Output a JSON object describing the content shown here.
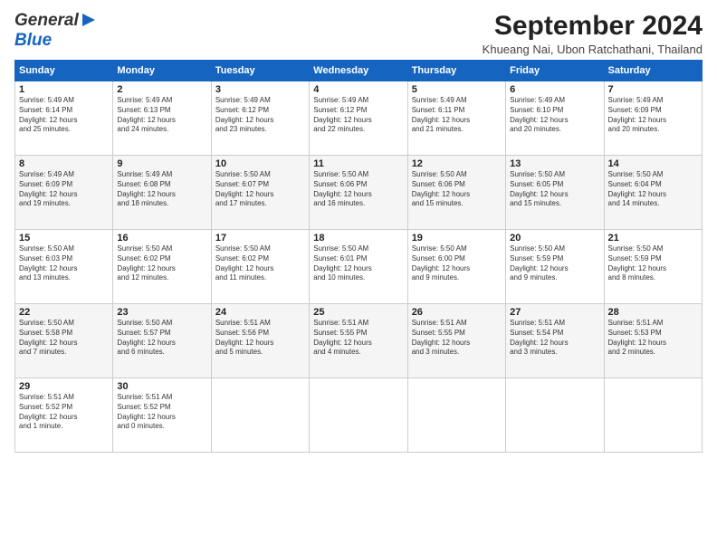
{
  "header": {
    "logo_general": "General",
    "logo_blue": "Blue",
    "month_title": "September 2024",
    "subtitle": "Khueang Nai, Ubon Ratchathani, Thailand"
  },
  "weekdays": [
    "Sunday",
    "Monday",
    "Tuesday",
    "Wednesday",
    "Thursday",
    "Friday",
    "Saturday"
  ],
  "weeks": [
    [
      {
        "day": "1",
        "lines": [
          "Sunrise: 5:49 AM",
          "Sunset: 6:14 PM",
          "Daylight: 12 hours",
          "and 25 minutes."
        ]
      },
      {
        "day": "2",
        "lines": [
          "Sunrise: 5:49 AM",
          "Sunset: 6:13 PM",
          "Daylight: 12 hours",
          "and 24 minutes."
        ]
      },
      {
        "day": "3",
        "lines": [
          "Sunrise: 5:49 AM",
          "Sunset: 6:12 PM",
          "Daylight: 12 hours",
          "and 23 minutes."
        ]
      },
      {
        "day": "4",
        "lines": [
          "Sunrise: 5:49 AM",
          "Sunset: 6:12 PM",
          "Daylight: 12 hours",
          "and 22 minutes."
        ]
      },
      {
        "day": "5",
        "lines": [
          "Sunrise: 5:49 AM",
          "Sunset: 6:11 PM",
          "Daylight: 12 hours",
          "and 21 minutes."
        ]
      },
      {
        "day": "6",
        "lines": [
          "Sunrise: 5:49 AM",
          "Sunset: 6:10 PM",
          "Daylight: 12 hours",
          "and 20 minutes."
        ]
      },
      {
        "day": "7",
        "lines": [
          "Sunrise: 5:49 AM",
          "Sunset: 6:09 PM",
          "Daylight: 12 hours",
          "and 20 minutes."
        ]
      }
    ],
    [
      {
        "day": "8",
        "lines": [
          "Sunrise: 5:49 AM",
          "Sunset: 6:09 PM",
          "Daylight: 12 hours",
          "and 19 minutes."
        ]
      },
      {
        "day": "9",
        "lines": [
          "Sunrise: 5:49 AM",
          "Sunset: 6:08 PM",
          "Daylight: 12 hours",
          "and 18 minutes."
        ]
      },
      {
        "day": "10",
        "lines": [
          "Sunrise: 5:50 AM",
          "Sunset: 6:07 PM",
          "Daylight: 12 hours",
          "and 17 minutes."
        ]
      },
      {
        "day": "11",
        "lines": [
          "Sunrise: 5:50 AM",
          "Sunset: 6:06 PM",
          "Daylight: 12 hours",
          "and 16 minutes."
        ]
      },
      {
        "day": "12",
        "lines": [
          "Sunrise: 5:50 AM",
          "Sunset: 6:06 PM",
          "Daylight: 12 hours",
          "and 15 minutes."
        ]
      },
      {
        "day": "13",
        "lines": [
          "Sunrise: 5:50 AM",
          "Sunset: 6:05 PM",
          "Daylight: 12 hours",
          "and 15 minutes."
        ]
      },
      {
        "day": "14",
        "lines": [
          "Sunrise: 5:50 AM",
          "Sunset: 6:04 PM",
          "Daylight: 12 hours",
          "and 14 minutes."
        ]
      }
    ],
    [
      {
        "day": "15",
        "lines": [
          "Sunrise: 5:50 AM",
          "Sunset: 6:03 PM",
          "Daylight: 12 hours",
          "and 13 minutes."
        ]
      },
      {
        "day": "16",
        "lines": [
          "Sunrise: 5:50 AM",
          "Sunset: 6:02 PM",
          "Daylight: 12 hours",
          "and 12 minutes."
        ]
      },
      {
        "day": "17",
        "lines": [
          "Sunrise: 5:50 AM",
          "Sunset: 6:02 PM",
          "Daylight: 12 hours",
          "and 11 minutes."
        ]
      },
      {
        "day": "18",
        "lines": [
          "Sunrise: 5:50 AM",
          "Sunset: 6:01 PM",
          "Daylight: 12 hours",
          "and 10 minutes."
        ]
      },
      {
        "day": "19",
        "lines": [
          "Sunrise: 5:50 AM",
          "Sunset: 6:00 PM",
          "Daylight: 12 hours",
          "and 9 minutes."
        ]
      },
      {
        "day": "20",
        "lines": [
          "Sunrise: 5:50 AM",
          "Sunset: 5:59 PM",
          "Daylight: 12 hours",
          "and 9 minutes."
        ]
      },
      {
        "day": "21",
        "lines": [
          "Sunrise: 5:50 AM",
          "Sunset: 5:59 PM",
          "Daylight: 12 hours",
          "and 8 minutes."
        ]
      }
    ],
    [
      {
        "day": "22",
        "lines": [
          "Sunrise: 5:50 AM",
          "Sunset: 5:58 PM",
          "Daylight: 12 hours",
          "and 7 minutes."
        ]
      },
      {
        "day": "23",
        "lines": [
          "Sunrise: 5:50 AM",
          "Sunset: 5:57 PM",
          "Daylight: 12 hours",
          "and 6 minutes."
        ]
      },
      {
        "day": "24",
        "lines": [
          "Sunrise: 5:51 AM",
          "Sunset: 5:56 PM",
          "Daylight: 12 hours",
          "and 5 minutes."
        ]
      },
      {
        "day": "25",
        "lines": [
          "Sunrise: 5:51 AM",
          "Sunset: 5:55 PM",
          "Daylight: 12 hours",
          "and 4 minutes."
        ]
      },
      {
        "day": "26",
        "lines": [
          "Sunrise: 5:51 AM",
          "Sunset: 5:55 PM",
          "Daylight: 12 hours",
          "and 3 minutes."
        ]
      },
      {
        "day": "27",
        "lines": [
          "Sunrise: 5:51 AM",
          "Sunset: 5:54 PM",
          "Daylight: 12 hours",
          "and 3 minutes."
        ]
      },
      {
        "day": "28",
        "lines": [
          "Sunrise: 5:51 AM",
          "Sunset: 5:53 PM",
          "Daylight: 12 hours",
          "and 2 minutes."
        ]
      }
    ],
    [
      {
        "day": "29",
        "lines": [
          "Sunrise: 5:51 AM",
          "Sunset: 5:52 PM",
          "Daylight: 12 hours",
          "and 1 minute."
        ]
      },
      {
        "day": "30",
        "lines": [
          "Sunrise: 5:51 AM",
          "Sunset: 5:52 PM",
          "Daylight: 12 hours",
          "and 0 minutes."
        ]
      },
      null,
      null,
      null,
      null,
      null
    ]
  ]
}
